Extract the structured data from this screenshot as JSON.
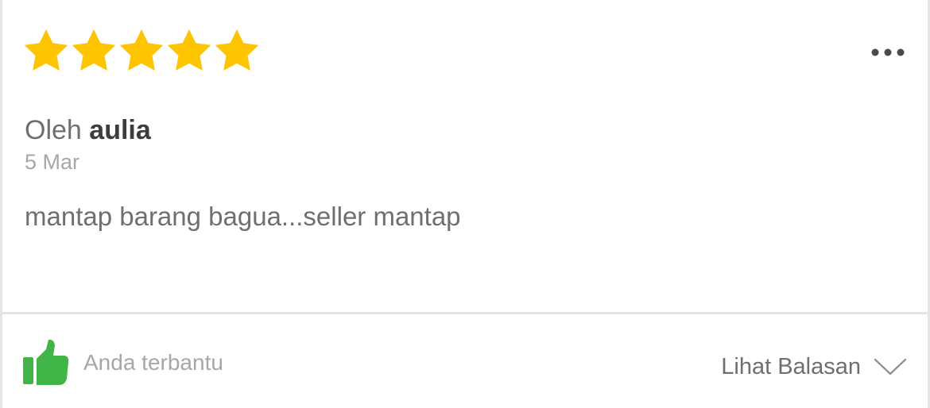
{
  "review": {
    "rating": 5,
    "rating_max": 5,
    "star_color": "#FFC400",
    "author_prefix": "Oleh",
    "author_name": "aulia",
    "date": "5 Mar",
    "text": "mantap barang bagua...seller mantap"
  },
  "actions": {
    "more_icon": "more-horizontal-icon",
    "helpful_icon": "thumbs-up-icon",
    "helpful_color": "#42B549",
    "helpful_label": "Anda terbantu",
    "view_replies_label": "Lihat Balasan",
    "view_replies_icon": "chevron-down-icon"
  }
}
